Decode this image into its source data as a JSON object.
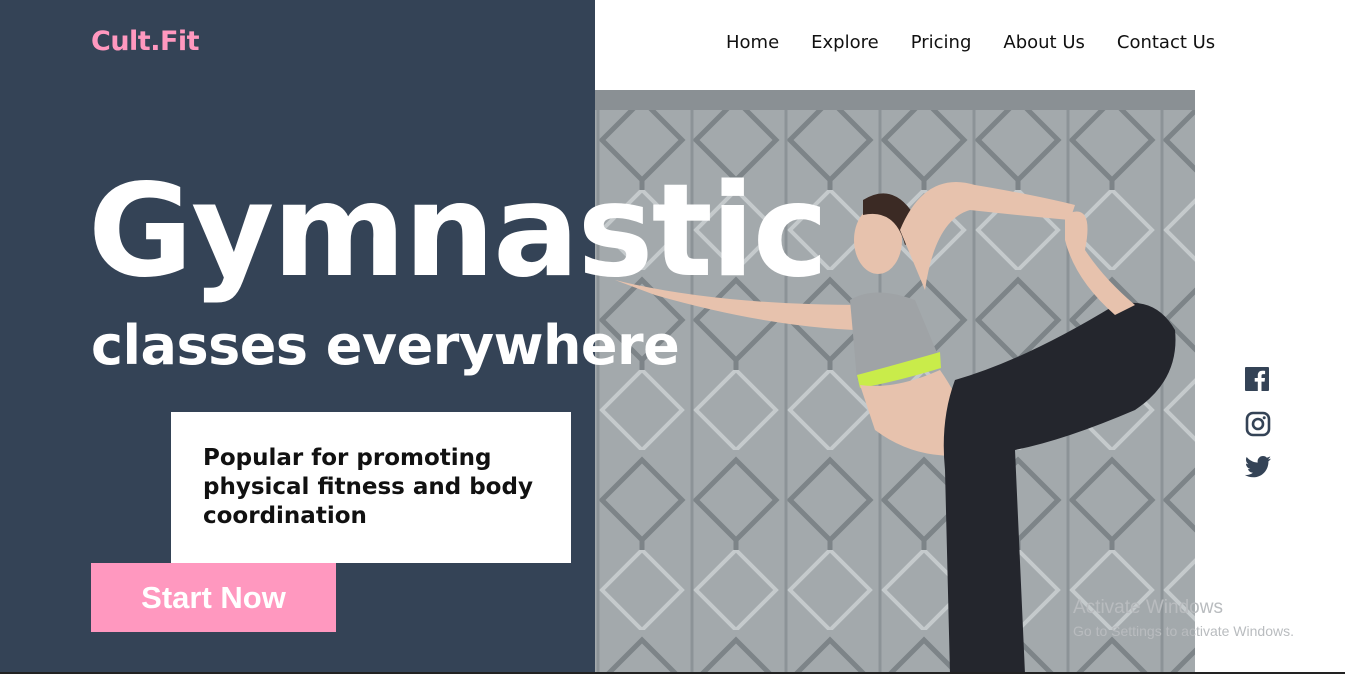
{
  "brand": {
    "logo": "Cult.Fit",
    "accent_color": "#ff98bf",
    "panel_color": "#344356"
  },
  "nav": {
    "items": [
      "Home",
      "Explore",
      "Pricing",
      "About Us",
      "Contact Us"
    ]
  },
  "hero": {
    "title": "Gymnastic",
    "subtitle": "classes everywhere",
    "description": "Popular for promoting physical fitness and body coordination",
    "cta_label": "Start Now"
  },
  "social": {
    "icons": [
      "facebook-icon",
      "instagram-icon",
      "twitter-icon"
    ]
  },
  "watermark": {
    "title": "Activate Windows",
    "subtitle": "Go to Settings to activate Windows."
  }
}
